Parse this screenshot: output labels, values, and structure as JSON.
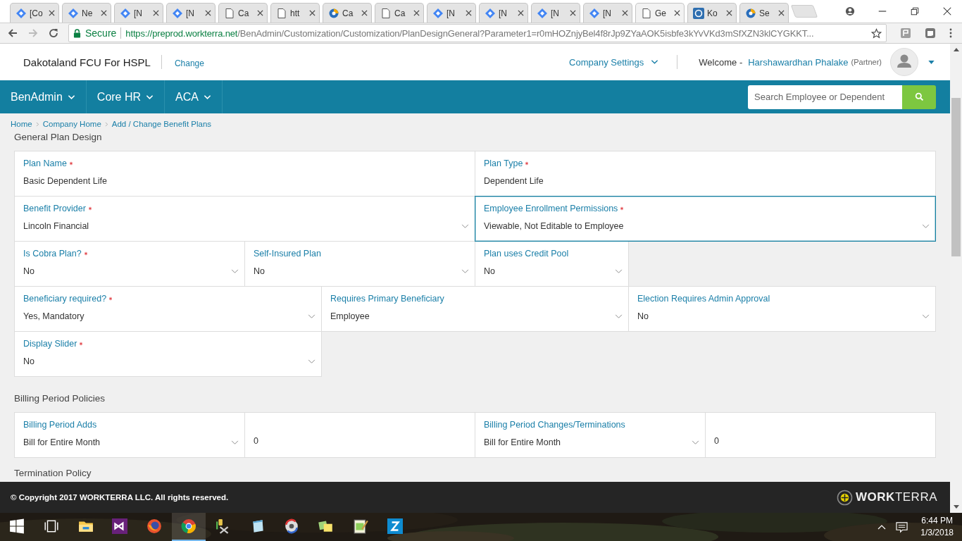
{
  "browser": {
    "tabs": [
      {
        "title": "[Co",
        "kind": "diamond",
        "selected": false
      },
      {
        "title": "Ne",
        "kind": "diamond",
        "selected": false
      },
      {
        "title": "[N",
        "kind": "diamond",
        "selected": false
      },
      {
        "title": "[N",
        "kind": "diamond",
        "selected": false
      },
      {
        "title": "Ca",
        "kind": "page",
        "selected": false
      },
      {
        "title": "htt",
        "kind": "page",
        "selected": false
      },
      {
        "title": "Ca",
        "kind": "swirl",
        "selected": false
      },
      {
        "title": "Ca",
        "kind": "page",
        "selected": false
      },
      {
        "title": "[N",
        "kind": "diamond",
        "selected": false
      },
      {
        "title": "[N",
        "kind": "diamond",
        "selected": false
      },
      {
        "title": "[N",
        "kind": "diamond",
        "selected": false
      },
      {
        "title": "[N",
        "kind": "diamond",
        "selected": false
      },
      {
        "title": "Ge",
        "kind": "page",
        "selected": true
      },
      {
        "title": "Ko",
        "kind": "wheel",
        "selected": false
      },
      {
        "title": "Se",
        "kind": "swirl",
        "selected": false
      }
    ],
    "address": {
      "secure_label": "Secure",
      "url_host": "https://preprod.workterra.net",
      "url_path": "/BenAdmin/Customization/Customization/PlanDesignGeneral?Parameter1=r0mHOZnjyBel4f8rJp9ZYaAOK5isbfe3kYvVKd3mSfXZN3klCYGKKT..."
    }
  },
  "header": {
    "company": "Dakotaland FCU For HSPL",
    "change_link": "Change",
    "company_settings": "Company Settings",
    "welcome": "Welcome -",
    "user_name": "Harshawardhan Phalake",
    "user_role": "(Partner)"
  },
  "nav": {
    "items": [
      "BenAdmin",
      "Core HR",
      "ACA"
    ],
    "search": {
      "placeholder": "Search Employee or Dependent"
    }
  },
  "breadcrumb": [
    "Home",
    "Company Home",
    "Add / Change Benefit Plans"
  ],
  "sections": [
    {
      "title": "General Plan Design",
      "fields": [
        {
          "kind": "text",
          "label": "Plan Name",
          "required": true,
          "value": "Basic Dependent Life",
          "focused": false
        },
        {
          "kind": "text",
          "label": "Plan Type",
          "required": true,
          "value": "Dependent Life",
          "focused": false
        },
        {
          "kind": "select",
          "label": "Benefit Provider",
          "required": true,
          "value": "Lincoln Financial",
          "focused": false
        },
        {
          "kind": "select",
          "label": "Employee Enrollment Permissions",
          "required": true,
          "value": "Viewable, Not Editable to Employee",
          "focused": true
        },
        {
          "kind": "select",
          "label": "Is Cobra Plan?",
          "required": true,
          "value": "No",
          "focused": false
        },
        {
          "kind": "select",
          "label": "Self-Insured Plan",
          "required": false,
          "value": "No",
          "focused": false
        },
        {
          "kind": "select",
          "label": "Plan uses Credit Pool",
          "required": false,
          "value": "No",
          "focused": false
        },
        {
          "kind": "select",
          "label": "Beneficiary required?",
          "required": true,
          "value": "Yes, Mandatory",
          "focused": false
        },
        {
          "kind": "select",
          "label": "Requires Primary Beneficiary",
          "required": false,
          "value": "Employee",
          "focused": false
        },
        {
          "kind": "select",
          "label": "Election Requires Admin Approval",
          "required": false,
          "value": "No",
          "focused": false
        },
        {
          "kind": "select",
          "label": "Display Slider",
          "required": true,
          "value": "No",
          "focused": false
        }
      ]
    },
    {
      "title": "Billing Period Policies",
      "fields": [
        {
          "kind": "select",
          "label": "Billing Period Adds",
          "required": false,
          "value": "Bill for Entire Month",
          "focused": false
        },
        {
          "kind": "input",
          "value": "0",
          "focused": false
        },
        {
          "kind": "select",
          "label": "Billing Period Changes/Terminations",
          "required": false,
          "value": "Bill for Entire Month",
          "focused": false
        },
        {
          "kind": "input",
          "value": "0",
          "focused": false
        }
      ]
    },
    {
      "title": "Termination Policy"
    }
  ],
  "footer": {
    "copyright": "© Copyright 2017 WORKTERRA LLC. All rights reserved.",
    "brand_bold": "WORK",
    "brand_light": "TERRA"
  },
  "taskbar": {
    "apps": [
      {
        "kind": "start",
        "selected": false
      },
      {
        "kind": "taskview",
        "selected": false
      },
      {
        "kind": "folder",
        "selected": false
      },
      {
        "kind": "vs",
        "selected": false
      },
      {
        "kind": "firefox",
        "selected": false
      },
      {
        "kind": "chrome",
        "selected": true
      },
      {
        "kind": "tools",
        "selected": false
      },
      {
        "kind": "notepad",
        "selected": false
      },
      {
        "kind": "sync",
        "selected": false
      },
      {
        "kind": "notes",
        "selected": false
      },
      {
        "kind": "editor",
        "selected": false
      },
      {
        "kind": "zapp",
        "selected": false
      }
    ],
    "time": "6:44 PM",
    "date": "1/3/2018"
  }
}
